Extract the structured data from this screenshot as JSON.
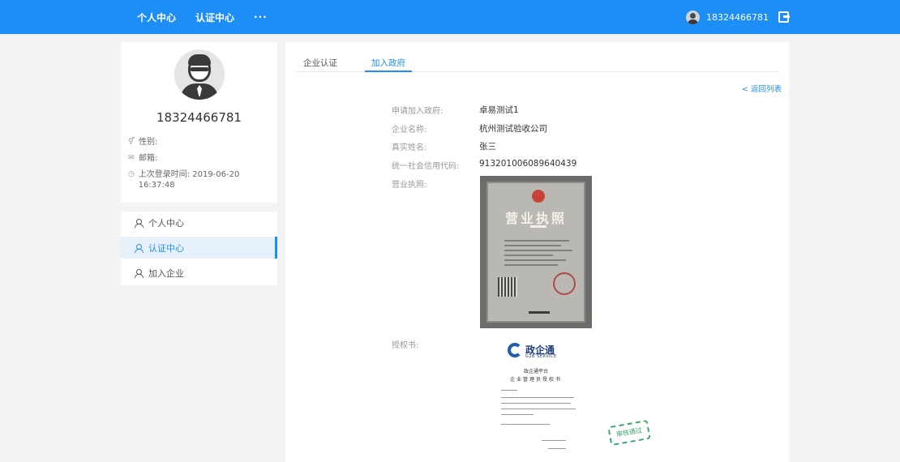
{
  "header": {
    "nav": [
      "个人中心",
      "认证中心",
      "···"
    ],
    "user_phone": "18324466781"
  },
  "profile": {
    "phone": "18324466781",
    "gender_label": "性别:",
    "email_label": "邮箱:",
    "last_login_label": "上次登录时间: 2019-06-20 16:37:48"
  },
  "menu": {
    "items": [
      "个人中心",
      "认证中心",
      "加入企业"
    ],
    "active": "认证中心"
  },
  "tabs": [
    "企业认证",
    "加入政府"
  ],
  "active_tab": "加入政府",
  "back_link": "< 返回列表",
  "fields": [
    {
      "label": "申请加入政府:",
      "value": "卓易测试1"
    },
    {
      "label": "企业名称:",
      "value": "杭州测试验收公司"
    },
    {
      "label": "真实姓名:",
      "value": "张三"
    },
    {
      "label": "统一社会信用代码:",
      "value": "913201006089640439"
    },
    {
      "label": "营业执照:",
      "value": ""
    },
    {
      "label": "授权书:",
      "value": ""
    }
  ],
  "license_image": {
    "title": "营业执照"
  },
  "auth_letter": {
    "logo_text": "政企通",
    "logo_sub": "G2B SERVICE",
    "platform": "政企通平台",
    "heading": "企业管理员授权书",
    "stamp": "审核通过"
  },
  "colors": {
    "primary": "#1e8ef7",
    "background": "#f2f3f5",
    "stamp_green": "#39a86a"
  }
}
